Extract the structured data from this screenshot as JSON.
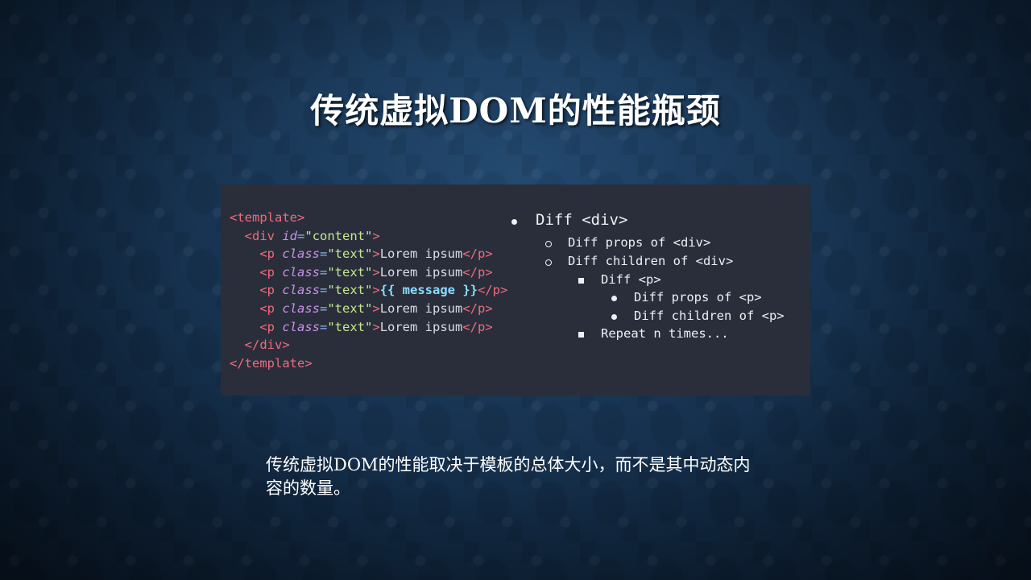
{
  "title": "传统虚拟DOM的性能瓶颈",
  "code_lines": [
    [
      {
        "t": "tag",
        "v": "<template>"
      }
    ],
    [
      {
        "t": "txt",
        "v": "  "
      },
      {
        "t": "tag",
        "v": "<div "
      },
      {
        "t": "attr",
        "v": "id"
      },
      {
        "t": "punct",
        "v": "="
      },
      {
        "t": "str",
        "v": "\"content\""
      },
      {
        "t": "tag",
        "v": ">"
      }
    ],
    [
      {
        "t": "txt",
        "v": "    "
      },
      {
        "t": "tag",
        "v": "<p "
      },
      {
        "t": "attr",
        "v": "class"
      },
      {
        "t": "punct",
        "v": "="
      },
      {
        "t": "str",
        "v": "\"text\""
      },
      {
        "t": "tag",
        "v": ">"
      },
      {
        "t": "txt",
        "v": "Lorem ipsum"
      },
      {
        "t": "tag",
        "v": "</p>"
      }
    ],
    [
      {
        "t": "txt",
        "v": "    "
      },
      {
        "t": "tag",
        "v": "<p "
      },
      {
        "t": "attr",
        "v": "class"
      },
      {
        "t": "punct",
        "v": "="
      },
      {
        "t": "str",
        "v": "\"text\""
      },
      {
        "t": "tag",
        "v": ">"
      },
      {
        "t": "txt",
        "v": "Lorem ipsum"
      },
      {
        "t": "tag",
        "v": "</p>"
      }
    ],
    [
      {
        "t": "txt",
        "v": "    "
      },
      {
        "t": "tag",
        "v": "<p "
      },
      {
        "t": "attr",
        "v": "class"
      },
      {
        "t": "punct",
        "v": "="
      },
      {
        "t": "str",
        "v": "\"text\""
      },
      {
        "t": "tag",
        "v": ">"
      },
      {
        "t": "mustache",
        "v": "{{ message }}"
      },
      {
        "t": "tag",
        "v": "</p>"
      }
    ],
    [
      {
        "t": "txt",
        "v": "    "
      },
      {
        "t": "tag",
        "v": "<p "
      },
      {
        "t": "attr",
        "v": "class"
      },
      {
        "t": "punct",
        "v": "="
      },
      {
        "t": "str",
        "v": "\"text\""
      },
      {
        "t": "tag",
        "v": ">"
      },
      {
        "t": "txt",
        "v": "Lorem ipsum"
      },
      {
        "t": "tag",
        "v": "</p>"
      }
    ],
    [
      {
        "t": "txt",
        "v": "    "
      },
      {
        "t": "tag",
        "v": "<p "
      },
      {
        "t": "attr",
        "v": "class"
      },
      {
        "t": "punct",
        "v": "="
      },
      {
        "t": "str",
        "v": "\"text\""
      },
      {
        "t": "tag",
        "v": ">"
      },
      {
        "t": "txt",
        "v": "Lorem ipsum"
      },
      {
        "t": "tag",
        "v": "</p>"
      }
    ],
    [
      {
        "t": "txt",
        "v": "  "
      },
      {
        "t": "tag",
        "v": "</div>"
      }
    ],
    [
      {
        "t": "tag",
        "v": "</template>"
      }
    ]
  ],
  "diff_list": [
    {
      "level": 0,
      "bullet": "disc",
      "text": "Diff <div>"
    },
    {
      "level": 1,
      "bullet": "circle",
      "text": "Diff props of <div>"
    },
    {
      "level": 1,
      "bullet": "circle",
      "text": "Diff children of <div>"
    },
    {
      "level": 2,
      "bullet": "square",
      "text": "Diff <p>"
    },
    {
      "level": 3,
      "bullet": "disc",
      "text": "Diff props of <p>"
    },
    {
      "level": 3,
      "bullet": "disc",
      "text": "Diff children of <p>"
    },
    {
      "level": 2,
      "bullet": "square",
      "text": "Repeat n times..."
    }
  ],
  "body_text": "传统虚拟DOM的性能取决于模板的总体大小，而不是其中动态内容的数量。"
}
